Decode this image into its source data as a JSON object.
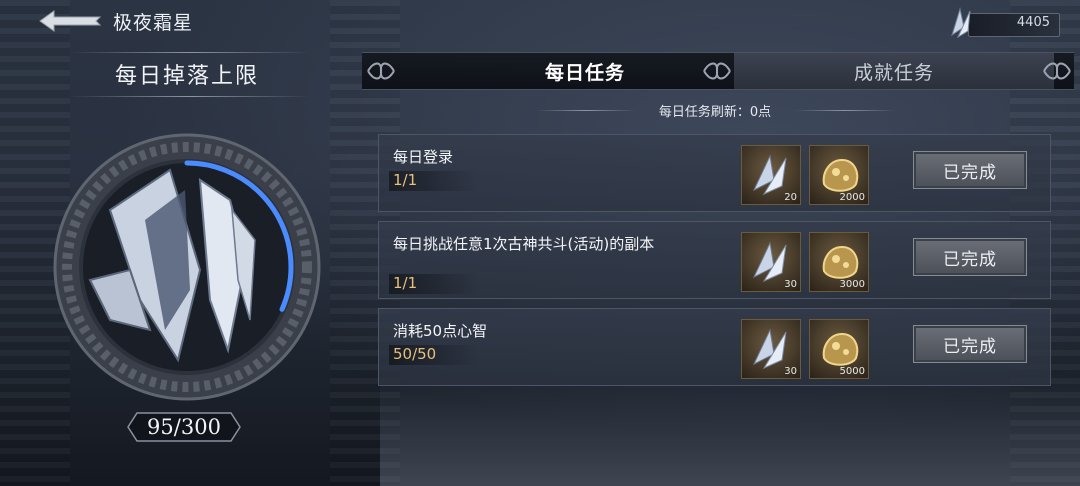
{
  "header": {
    "title": "极夜霜星",
    "currency_value": "4405",
    "back_icon": "back-arrow-icon"
  },
  "left_panel": {
    "title": "每日掉落上限",
    "counter": "95/300",
    "progress_fraction": 0.3167
  },
  "tabs": [
    {
      "label": "每日任务",
      "active": true
    },
    {
      "label": "成就任务",
      "active": false
    }
  ],
  "refresh_text": "每日任务刷新：0点",
  "tasks": [
    {
      "name": "每日登录",
      "progress": "1/1",
      "rewards": [
        {
          "icon": "ice-crystal-icon",
          "amount": "20"
        },
        {
          "icon": "gold-ore-icon",
          "amount": "2000"
        }
      ],
      "button": "已完成"
    },
    {
      "name": "每日挑战任意1次古神共斗(活动)的副本",
      "progress": "1/1",
      "rewards": [
        {
          "icon": "ice-crystal-icon",
          "amount": "30"
        },
        {
          "icon": "gold-ore-icon",
          "amount": "3000"
        }
      ],
      "button": "已完成"
    },
    {
      "name": "消耗50点心智",
      "progress": "50/50",
      "rewards": [
        {
          "icon": "ice-crystal-icon",
          "amount": "30"
        },
        {
          "icon": "gold-ore-icon",
          "amount": "5000"
        }
      ],
      "button": "已完成"
    }
  ],
  "colors": {
    "progress_ring": "#4a8cff",
    "progress_text": "#e7c07a"
  }
}
